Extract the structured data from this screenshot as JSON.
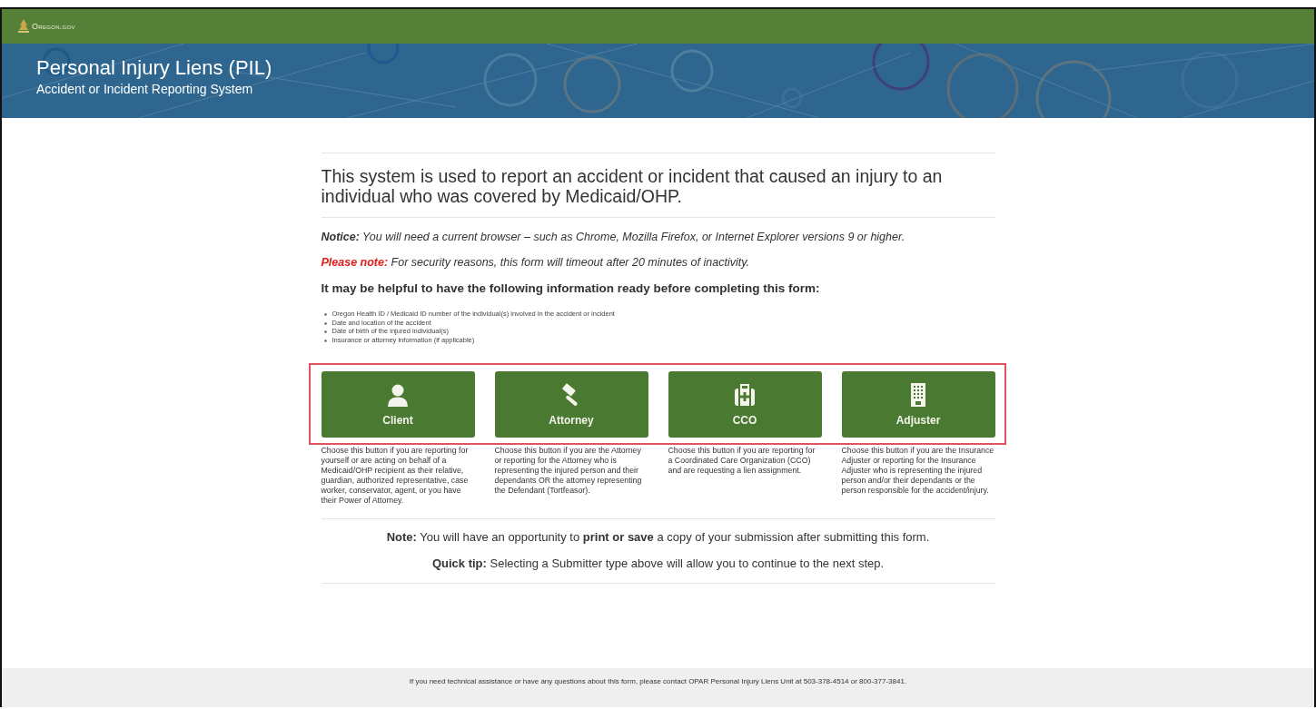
{
  "top_bar": {
    "logo_text": "Oregon.gov"
  },
  "banner": {
    "title": "Personal Injury Liens (PIL)",
    "subtitle": "Accident or Incident Reporting System"
  },
  "intro": "This system is used to report an accident or incident that caused an injury to an individual who was covered by Medicaid/OHP.",
  "notices": [
    {
      "kind": "notice",
      "label": "Notice:",
      "text": "You will need a current browser – such as Chrome, Mozilla Firefox, or Internet Explorer versions 9 or higher."
    },
    {
      "kind": "warning",
      "label": "Please note:",
      "text": "For security reasons, this form will timeout after 20 minutes of inactivity."
    }
  ],
  "checklist": {
    "heading": "It may be helpful to have the following information ready before completing this form:",
    "items": [
      "Oregon Health ID / Medicaid ID number of the individual(s) involved in the accident or incident",
      "Date and location of the accident",
      "Date of birth of the injured individual(s)",
      "Insurance or attorney information (if applicable)"
    ]
  },
  "submitter_types": [
    {
      "kind": "person",
      "label": "Client",
      "description": "Choose this button if you are reporting for yourself or are acting on behalf of a Medicaid/OHP recipient as their relative, guardian, authorized representative, case worker, conservator, agent, or you have their Power of Attorney."
    },
    {
      "kind": "gavel",
      "label": "Attorney",
      "description": "Choose this button if you are the Attorney or reporting for the Attorney who is representing the injured person and their dependants OR the attorney representing the Defendant (Tortfeasor)."
    },
    {
      "kind": "medkit",
      "label": "CCO",
      "description": "Choose this button if you are reporting for a Coordinated Care Organization (CCO) and are requesting a lien assignment."
    },
    {
      "kind": "building",
      "label": "Adjuster",
      "description": "Choose this button if you are the Insurance Adjuster or reporting for the Insurance Adjuster who is representing the injured person and/or their dependants or the person responsible for the accident/injury."
    }
  ],
  "notes": [
    "**Note:** You will have an opportunity to **print or save** a copy of your submission after submitting this form.",
    "**Quick tip:** Selecting a Submitter type above will allow you to continue to the next step."
  ],
  "footer": {
    "text": "If you need technical assistance or have any questions about this form, please contact OPAR Personal Injury Liens Unit at 503-378-4514 or 800-377-3841."
  }
}
